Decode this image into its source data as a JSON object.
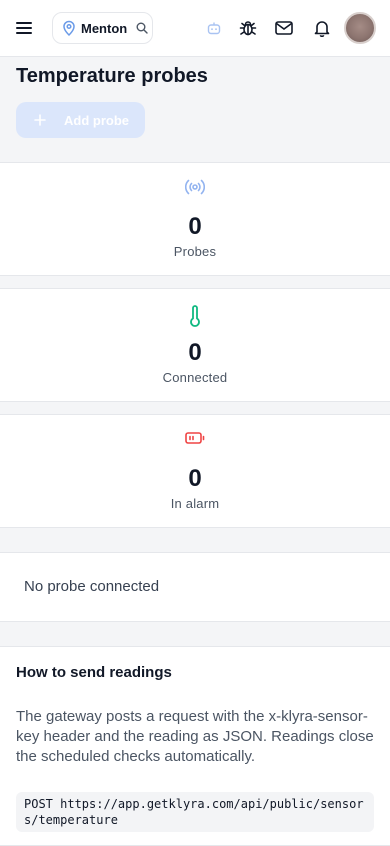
{
  "header": {
    "location": "Menton",
    "icons": {
      "menu": "menu-icon",
      "location": "map-pin-icon",
      "search": "search-icon",
      "bot": "robot-icon",
      "bug": "bug-icon",
      "mail": "mail-icon",
      "bell": "bell-icon"
    }
  },
  "page": {
    "title": "Temperature probes",
    "add_button": "Add probe"
  },
  "stats": [
    {
      "value": "0",
      "label": "Probes",
      "icon": "broadcast-icon",
      "color": "#93b4f0"
    },
    {
      "value": "0",
      "label": "Connected",
      "icon": "thermometer-icon",
      "color": "#10b981"
    },
    {
      "value": "0",
      "label": "In alarm",
      "icon": "battery-low-icon",
      "color": "#ef4444"
    }
  ],
  "empty_state": {
    "text": "No probe connected"
  },
  "instructions": {
    "title": "How to send readings",
    "body": "The gateway posts a request with the x-klyra-sensor-key header and the reading as JSON. Readings close the scheduled checks automatically.",
    "code": "POST https://app.getklyra.com/api/public/sensors/temperature"
  }
}
